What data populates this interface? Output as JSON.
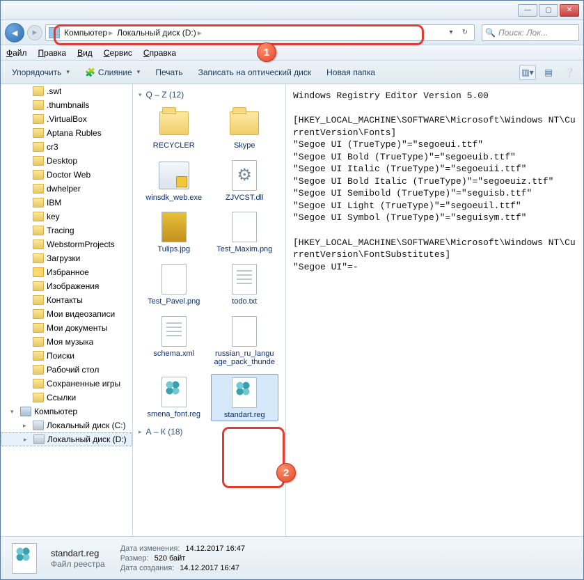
{
  "titlebar": {
    "min": "—",
    "max": "▢",
    "close": "✕"
  },
  "nav": {
    "crumbs": [
      "Компьютер",
      "Локальный диск (D:)"
    ],
    "search_placeholder": "Поиск: Лок..."
  },
  "menu": {
    "items": [
      "Файл",
      "Правка",
      "Вид",
      "Сервис",
      "Справка"
    ]
  },
  "toolbar": {
    "organize": "Упорядочить",
    "merge": "Слияние",
    "print": "Печать",
    "burn": "Записать на оптический диск",
    "newfolder": "Новая папка"
  },
  "tree": {
    "items": [
      {
        "label": ".swt",
        "lvl": 1,
        "icon": "folder"
      },
      {
        "label": ".thumbnails",
        "lvl": 1,
        "icon": "folder"
      },
      {
        "label": ".VirtualBox",
        "lvl": 1,
        "icon": "folder"
      },
      {
        "label": "Aptana Rubles",
        "lvl": 1,
        "icon": "folder"
      },
      {
        "label": "cr3",
        "lvl": 1,
        "icon": "folder"
      },
      {
        "label": "Desktop",
        "lvl": 1,
        "icon": "folder"
      },
      {
        "label": "Doctor Web",
        "lvl": 1,
        "icon": "folder"
      },
      {
        "label": "dwhelper",
        "lvl": 1,
        "icon": "folder"
      },
      {
        "label": "IBM",
        "lvl": 1,
        "icon": "folder"
      },
      {
        "label": "key",
        "lvl": 1,
        "icon": "folder"
      },
      {
        "label": "Tracing",
        "lvl": 1,
        "icon": "folder"
      },
      {
        "label": "WebstormProjects",
        "lvl": 1,
        "icon": "folder"
      },
      {
        "label": "Загрузки",
        "lvl": 1,
        "icon": "folder"
      },
      {
        "label": "Избранное",
        "lvl": 1,
        "icon": "fav"
      },
      {
        "label": "Изображения",
        "lvl": 1,
        "icon": "folder"
      },
      {
        "label": "Контакты",
        "lvl": 1,
        "icon": "folder"
      },
      {
        "label": "Мои видеозаписи",
        "lvl": 1,
        "icon": "folder"
      },
      {
        "label": "Мои документы",
        "lvl": 1,
        "icon": "folder"
      },
      {
        "label": "Моя музыка",
        "lvl": 1,
        "icon": "folder"
      },
      {
        "label": "Поиски",
        "lvl": 1,
        "icon": "folder"
      },
      {
        "label": "Рабочий стол",
        "lvl": 1,
        "icon": "folder"
      },
      {
        "label": "Сохраненные игры",
        "lvl": 1,
        "icon": "folder"
      },
      {
        "label": "Ссылки",
        "lvl": 1,
        "icon": "folder"
      },
      {
        "label": "Компьютер",
        "lvl": 0,
        "icon": "pc",
        "tw": "▾"
      },
      {
        "label": "Локальный диск (C:)",
        "lvl": 1,
        "icon": "disk",
        "tw": "▸"
      },
      {
        "label": "Локальный диск (D:)",
        "lvl": 1,
        "icon": "disk",
        "tw": "▸",
        "sel": true
      }
    ]
  },
  "files": {
    "group1_label": "Q – Z (12)",
    "group2_label": "А – К (18)",
    "items": [
      {
        "name": "RECYCLER",
        "type": "folder"
      },
      {
        "name": "Skype",
        "type": "folder"
      },
      {
        "name": "winsdk_web.exe",
        "type": "exe"
      },
      {
        "name": "ZJVCST.dll",
        "type": "gear"
      },
      {
        "name": "Tulips.jpg",
        "type": "img"
      },
      {
        "name": "Test_Maxim.png",
        "type": "page"
      },
      {
        "name": "Test_Pavel.png",
        "type": "page"
      },
      {
        "name": "todo.txt",
        "type": "txt"
      },
      {
        "name": "schema.xml",
        "type": "txt"
      },
      {
        "name": "russian_ru_language_pack_thunde",
        "type": "page"
      },
      {
        "name": "smena_font.reg",
        "type": "reg"
      },
      {
        "name": "standart.reg",
        "type": "reg",
        "sel": true
      }
    ]
  },
  "preview": {
    "text": "Windows Registry Editor Version 5.00\n\n[HKEY_LOCAL_MACHINE\\SOFTWARE\\Microsoft\\Windows NT\\CurrentVersion\\Fonts]\n\"Segoe UI (TrueType)\"=\"segoeui.ttf\"\n\"Segoe UI Bold (TrueType)\"=\"segoeuib.ttf\"\n\"Segoe UI Italic (TrueType)\"=\"segoeuii.ttf\"\n\"Segoe UI Bold Italic (TrueType)\"=\"segoeuiz.ttf\"\n\"Segoe UI Semibold (TrueType)\"=\"seguisb.ttf\"\n\"Segoe UI Light (TrueType)\"=\"segoeuil.ttf\"\n\"Segoe UI Symbol (TrueType)\"=\"seguisym.ttf\"\n\n[HKEY_LOCAL_MACHINE\\SOFTWARE\\Microsoft\\Windows NT\\CurrentVersion\\FontSubstitutes]\n\"Segoe UI\"=-"
  },
  "details": {
    "name": "standart.reg",
    "type": "Файл реестра",
    "mod_label": "Дата изменения:",
    "mod_value": "14.12.2017 16:47",
    "size_label": "Размер:",
    "size_value": "520 байт",
    "created_label": "Дата создания:",
    "created_value": "14.12.2017 16:47"
  },
  "callouts": {
    "b1": "1",
    "b2": "2"
  }
}
